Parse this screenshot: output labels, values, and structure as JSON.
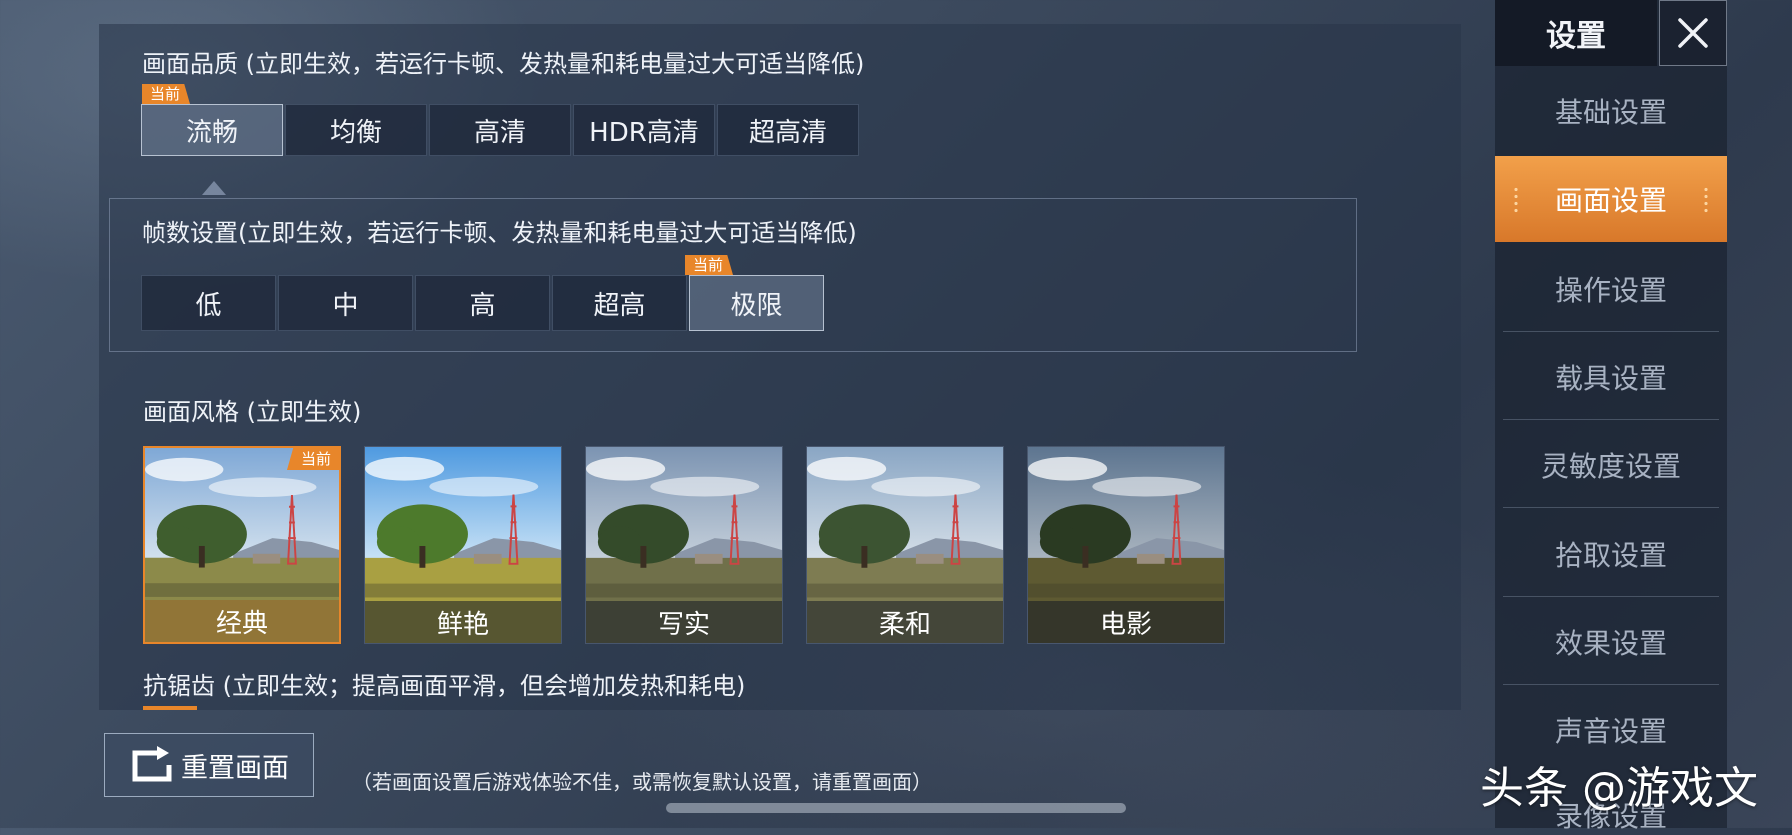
{
  "quality": {
    "title": "画面品质 (立即生效，若运行卡顿、发热量和耗电量过大可适当降低)",
    "current_badge": "当前",
    "options": [
      "流畅",
      "均衡",
      "高清",
      "HDR高清",
      "超高清"
    ],
    "selected": 0
  },
  "fps": {
    "title": "帧数设置(立即生效，若运行卡顿、发热量和耗电量过大可适当降低)",
    "current_badge": "当前",
    "options": [
      "低",
      "中",
      "高",
      "超高",
      "极限"
    ],
    "selected": 4
  },
  "style": {
    "title": "画面风格 (立即生效)",
    "current_badge": "当前",
    "options": [
      "经典",
      "鲜艳",
      "写实",
      "柔和",
      "电影"
    ],
    "selected": 0
  },
  "antialias": {
    "title": "抗锯齿 (立即生效；提高画面平滑，但会增加发热和耗电)"
  },
  "footer": {
    "reset_label": "重置画面",
    "reset_hint": "（若画面设置后游戏体验不佳，或需恢复默认设置，请重置画面）",
    "watermark": "头条 @游戏文"
  },
  "sidebar": {
    "title": "设置",
    "items": [
      "基础设置",
      "画面设置",
      "操作设置",
      "载具设置",
      "灵敏度设置",
      "拾取设置",
      "效果设置",
      "声音设置",
      "录像设置"
    ],
    "selected": 1
  },
  "colors": {
    "accent": "#e8862a",
    "active_tab_top": "#f2a04a",
    "active_tab_bottom": "#d8782a"
  },
  "icons": [
    "close-icon",
    "reset-icon",
    "grip-icon"
  ]
}
